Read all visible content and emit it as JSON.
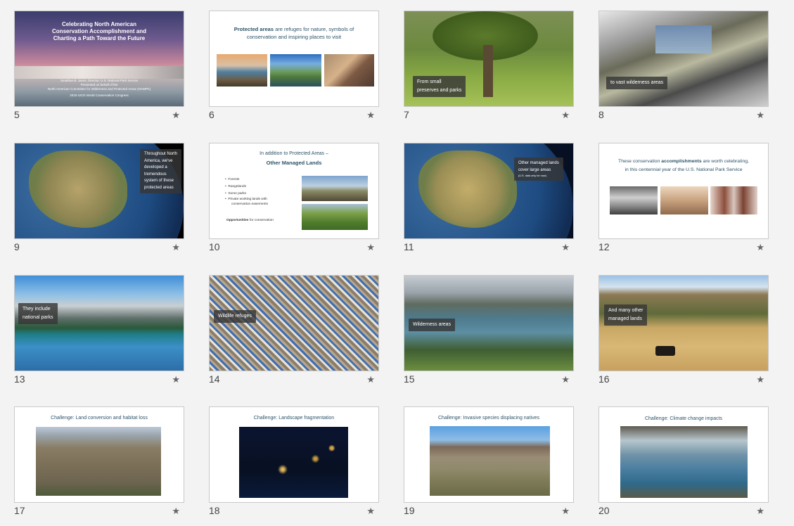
{
  "colors": {
    "accent": "#2c5369",
    "caption_bg": "#3a3a3a"
  },
  "slides": [
    {
      "number": "5",
      "title_lines": [
        "Celebrating North American",
        "Conservation Accomplishment and",
        "Charting a Path Toward the Future"
      ],
      "sub_lines": [
        "Jonathan B. Jarvis, Director, U.S. National Park Service",
        "Presented on behalf of the",
        "North American Committee for Wilderness and Protected Areas (NAWPA)",
        "2016 IUCN World Conservation Congress"
      ]
    },
    {
      "number": "6",
      "bold": "Protected areas",
      "text": " are refuges for nature, symbols of",
      "line2": "conservation and inspiring places to visit"
    },
    {
      "number": "7",
      "caption_lines": [
        "From small",
        "preserves and parks"
      ]
    },
    {
      "number": "8",
      "caption_lines": [
        "to vast wilderness areas"
      ]
    },
    {
      "number": "9",
      "caption_lines": [
        "Throughout North",
        "America, we've",
        "developed a",
        "tremendous",
        "system of these",
        "protected areas"
      ]
    },
    {
      "number": "10",
      "heading": "In addition to Protected Areas –",
      "heading_bold": "Other Managed Lands",
      "bullets": [
        "Forests",
        "Rangelands",
        "Some parks",
        "Private working lands with",
        "conservation easements"
      ],
      "footer_bold": "Opportunities",
      "footer_text": " for conservation"
    },
    {
      "number": "11",
      "caption_lines": [
        "Other managed lands",
        "cover large areas"
      ],
      "caption_note": "(U.S. data only for now)"
    },
    {
      "number": "12",
      "text_pre": "These conservation ",
      "bold": "accomplishments",
      "text_post": " are worth celebrating,",
      "line2": "in this centennial year of the U.S. National Park Service"
    },
    {
      "number": "13",
      "caption_lines": [
        "They include",
        "national parks"
      ]
    },
    {
      "number": "14",
      "caption_lines": [
        "Wildlife refuges"
      ]
    },
    {
      "number": "15",
      "caption_lines": [
        "Wilderness areas"
      ]
    },
    {
      "number": "16",
      "caption_lines": [
        "And many other",
        "managed lands"
      ]
    },
    {
      "number": "17",
      "heading": "Challenge:   Land conversion and habitat loss"
    },
    {
      "number": "18",
      "heading": "Challenge:  Landscape fragmentation"
    },
    {
      "number": "19",
      "heading": "Challenge:  Invasive species displacing natives"
    },
    {
      "number": "20",
      "heading": "Challenge:  Climate change impacts"
    }
  ],
  "icons": {
    "star": "★"
  }
}
